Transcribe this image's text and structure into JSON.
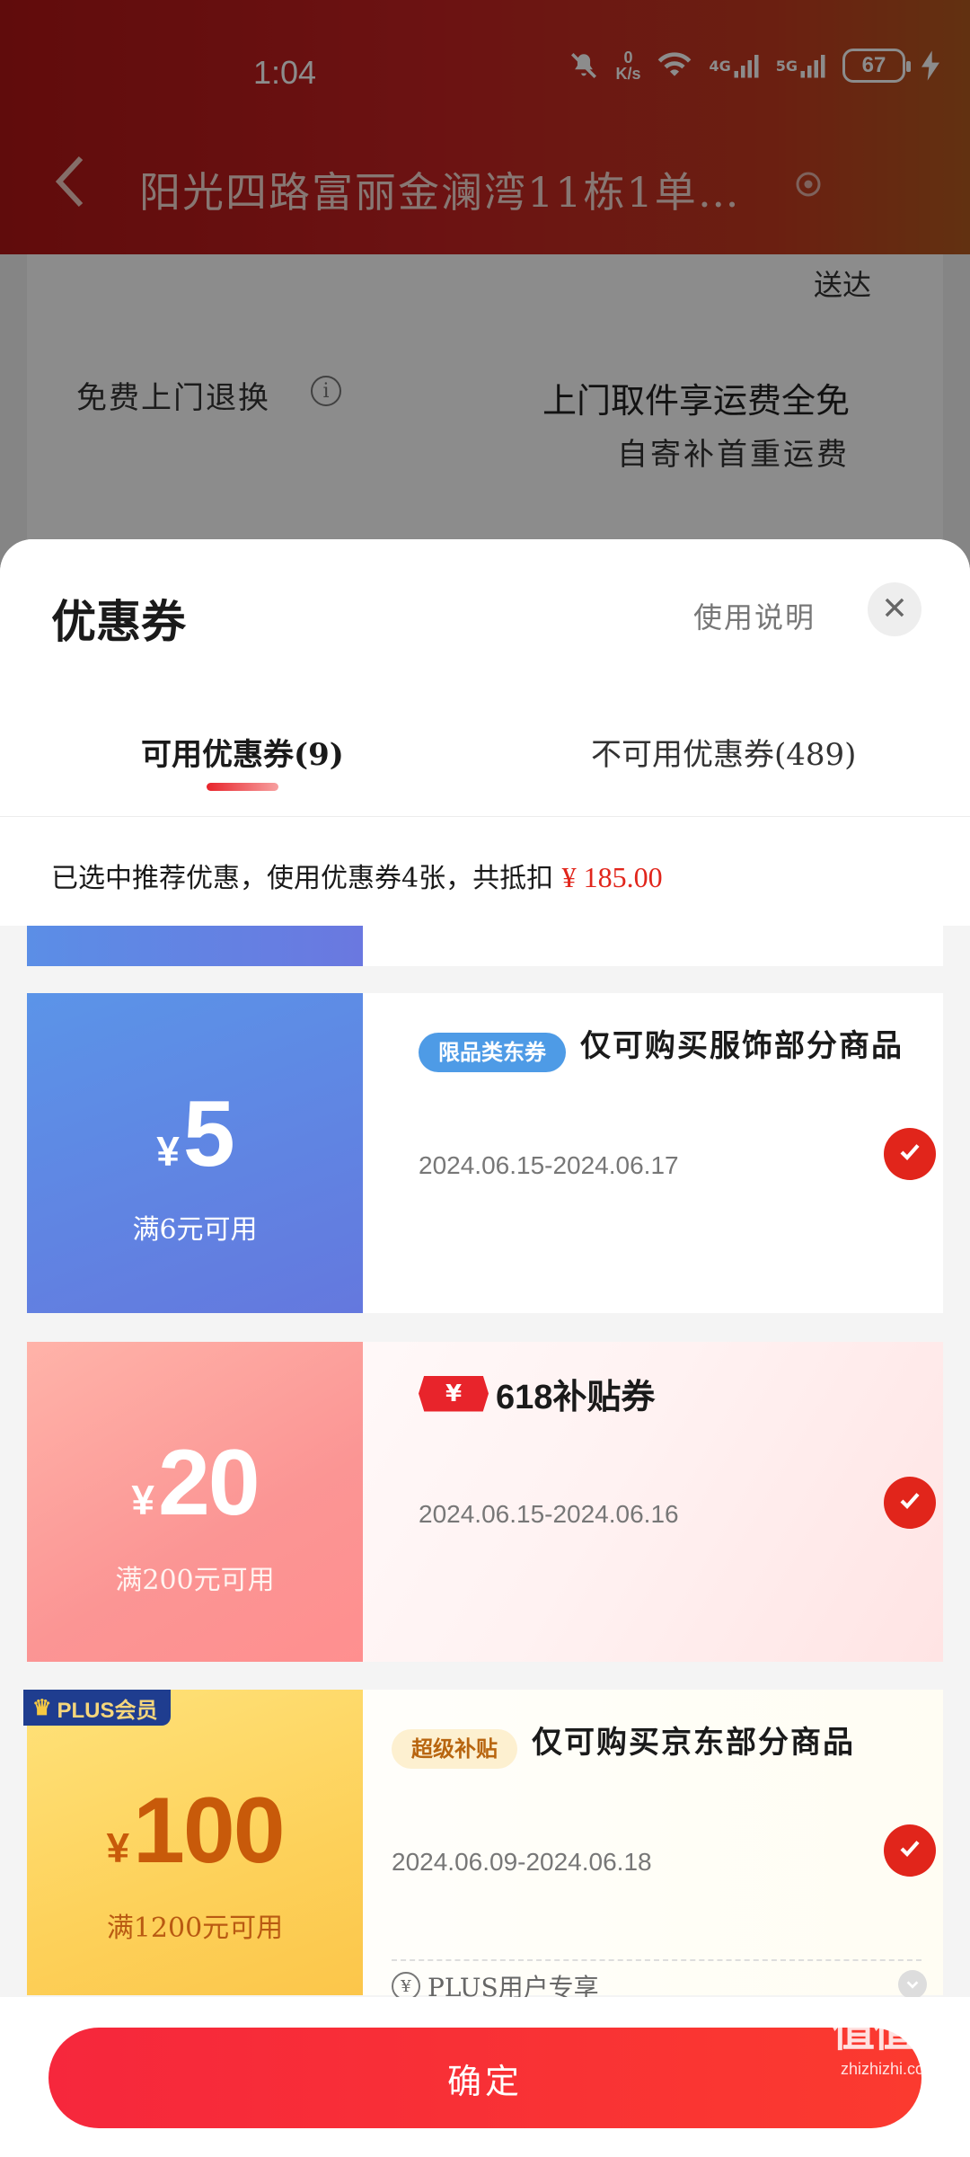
{
  "status_bar": {
    "time": "1:04",
    "net_speed_value": "0",
    "net_speed_unit": "K/s",
    "signal_4g": "4G",
    "signal_5g": "5G",
    "battery": "67"
  },
  "nav": {
    "title": "阳光四路富丽金澜湾11栋1单…"
  },
  "background": {
    "delivery_text": "送达",
    "free_return": "免费上门退换",
    "info_icon": "i",
    "pickup_title": "上门取件享运费全免",
    "self_send": "自寄补首重运费"
  },
  "sheet": {
    "title": "优惠券",
    "usage_link": "使用说明",
    "tabs": [
      {
        "label": "可用优惠券(9)"
      },
      {
        "label": "不可用优惠券(489)"
      }
    ],
    "summary_text": "已选中推荐优惠，使用优惠券4张，共抵扣",
    "summary_amount": "¥ 185.00"
  },
  "coupons": [
    {
      "currency": "¥",
      "amount": "5",
      "condition": "满6元可用",
      "tag": "限品类东券",
      "description": "仅可购买服饰部分商品",
      "validity": "2024.06.15-2024.06.17"
    },
    {
      "currency": "¥",
      "amount": "20",
      "condition": "满200元可用",
      "badge_symbol": "¥",
      "badge_title": "618补贴券",
      "validity": "2024.06.15-2024.06.16"
    },
    {
      "currency": "¥",
      "amount": "100",
      "condition": "满1200元可用",
      "member_badge": "PLUS会员",
      "tag": "超级补贴",
      "description": "仅可购买京东部分商品",
      "validity": "2024.06.09-2024.06.18",
      "plus_only_icon": "¥",
      "plus_only": "PLUS用户专享"
    }
  ],
  "footer": {
    "confirm_label": "确定"
  },
  "watermark": {
    "text": "值值值",
    "sub": "zhizhizhi.com"
  },
  "colors": {
    "accent_red": "#e1251b",
    "header_red": "#b01616",
    "coupon_blue": "#5b94e8",
    "coupon_pink": "#fb9594",
    "coupon_gold": "#fdd15a"
  }
}
